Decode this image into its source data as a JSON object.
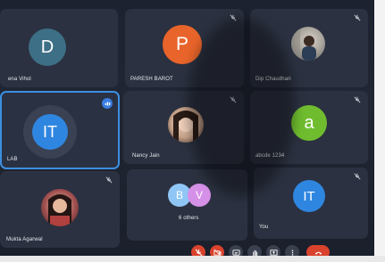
{
  "participants": [
    {
      "name": "ena Vihol",
      "initial": "D",
      "color": "#3d6f86"
    },
    {
      "name": "PARESH BAROT",
      "initial": "P",
      "color": "#e8642a"
    },
    {
      "name": "Dip Chaudhari",
      "initial": "",
      "color": "#8b9aa4"
    },
    {
      "name": "LAB",
      "initial": "IT",
      "color": "#2f86e0"
    },
    {
      "name": "Nancy Jain",
      "initial": "",
      "color": "#c9a48c"
    },
    {
      "name": "abcde 1234",
      "initial": "a",
      "color": "#6fbd2f"
    },
    {
      "name": "Mukta Agarwal",
      "initial": "",
      "color": "#a15050"
    },
    {
      "name": "6 others",
      "initial": "B",
      "initial2": "V",
      "color": "#8fc6f5",
      "color2": "#d590e8"
    },
    {
      "name": "You",
      "initial": "IT",
      "color": "#2f86e0"
    }
  ],
  "toolbar": {
    "buttons": [
      "mic-off-icon",
      "camera-off-icon",
      "captions-icon",
      "raise-hand-icon",
      "present-icon",
      "more-icon",
      "end-call-icon"
    ],
    "end_color": "#d9432e",
    "muted_color": "#d9432e"
  }
}
